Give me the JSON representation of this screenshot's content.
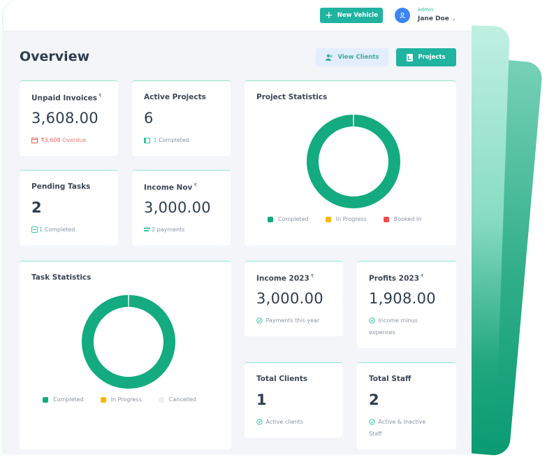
{
  "header": {
    "new_vehicle_label": "New Vehicle",
    "user_role": "Admin",
    "user_name": "Jane Doe"
  },
  "page": {
    "title": "Overview",
    "view_clients_label": "View Clients",
    "projects_label": "Projects"
  },
  "cards": {
    "unpaid_invoices": {
      "title": "Unpaid Invoices",
      "currency": "₹",
      "value": "3,608.00",
      "sub_amount": "₹3,608",
      "sub_text": "Overdue"
    },
    "active_projects": {
      "title": "Active Projects",
      "value": "6",
      "sub_count": "1",
      "sub_text": "Completed"
    },
    "pending_tasks": {
      "title": "Pending Tasks",
      "value": "2",
      "sub_count": "1",
      "sub_text": "Completed"
    },
    "income_nov": {
      "title": "Income Nov",
      "currency": "₹",
      "value": "3,000.00",
      "sub_count": "2",
      "sub_text": "payments"
    },
    "income_year": {
      "title": "Income 2023",
      "currency": "₹",
      "value": "3,000.00",
      "sub_text": "Payments this year"
    },
    "profits_year": {
      "title": "Profits 2023",
      "currency": "₹",
      "value": "1,908.00",
      "sub_text": "Income minus expenses"
    },
    "total_clients": {
      "title": "Total Clients",
      "value": "1",
      "sub_text": "Active clients"
    },
    "total_staff": {
      "title": "Total Staff",
      "value": "2",
      "sub_text": "Active & Inactive Staff"
    }
  },
  "chart_data": [
    {
      "type": "pie",
      "title": "Project Statistics",
      "donut": true,
      "categories": [
        "Completed",
        "In Progress",
        "Booked In"
      ],
      "values": [
        1,
        0,
        0
      ],
      "colors": [
        "#13ab7f",
        "#fcb900",
        "#eb4d4b"
      ],
      "legend": "bottom"
    },
    {
      "type": "pie",
      "title": "Task Statistics",
      "donut": true,
      "categories": [
        "Completed",
        "In Progress",
        "Cancelled"
      ],
      "values": [
        1,
        0,
        0
      ],
      "colors": [
        "#13ab7f",
        "#fcb900",
        "#eef0f4"
      ],
      "legend": "bottom"
    }
  ]
}
